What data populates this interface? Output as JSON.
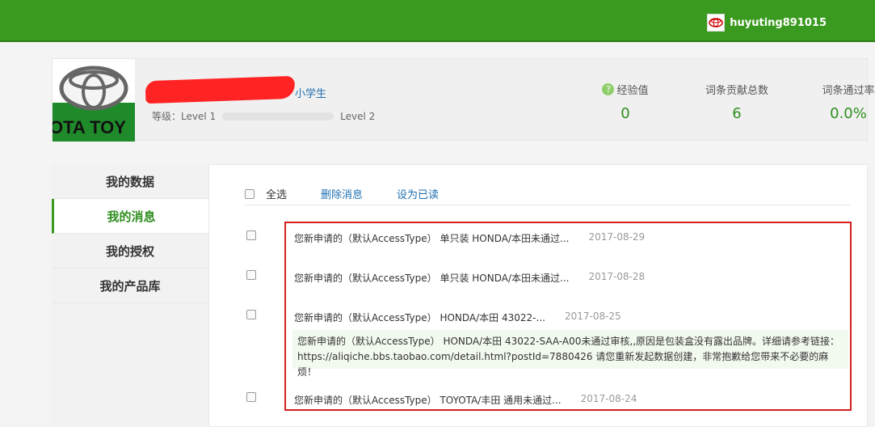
{
  "header": {
    "username": "huyuting891015"
  },
  "profile": {
    "rank_title": "小学生",
    "level_label": "等级：",
    "level_current": "Level 1",
    "level_next": "Level 2",
    "level_progress": 0,
    "avatar_text": "OTA TOY",
    "stats": [
      {
        "label": "经验值",
        "value": "0",
        "icon": "question-icon"
      },
      {
        "label": "词条贡献总数",
        "value": "6"
      },
      {
        "label": "词条通过率",
        "value": "0.0%"
      }
    ]
  },
  "sidebar": {
    "items": [
      {
        "label": "我的数据"
      },
      {
        "label": "我的消息"
      },
      {
        "label": "我的授权"
      },
      {
        "label": "我的产品库"
      }
    ],
    "active_index": 1
  },
  "toolbar": {
    "select_all": "全选",
    "delete": "删除消息",
    "mark_read": "设为已读"
  },
  "messages": [
    {
      "text": "您新申请的（默认AccessType） 单只装 HONDA/本田未通过...",
      "date": "2017-08-29"
    },
    {
      "text": "您新申请的（默认AccessType） 单只装 HONDA/本田未通过...",
      "date": "2017-08-28"
    },
    {
      "text": "您新申请的（默认AccessType） HONDA/本田 43022-...",
      "date": "2017-08-25"
    },
    {
      "text": "您新申请的（默认AccessType） TOYOTA/丰田 通用未通过...",
      "date": "2017-08-24"
    }
  ],
  "message_detail": {
    "line1": "您新申请的（默认AccessType） HONDA/本田 43022-SAA-A00未通过审核,,原因是包装盒没有露出品牌。详细请参考链接：",
    "line2": "https://aliqiche.bbs.taobao.com/detail.html?postId=7880426 请您重新发起数据创建，非常抱歉给您带来不必要的麻烦！"
  },
  "colors": {
    "brand_green": "#3a9a1f",
    "highlight_red": "#d62020",
    "link_blue": "#1f6fb0"
  }
}
